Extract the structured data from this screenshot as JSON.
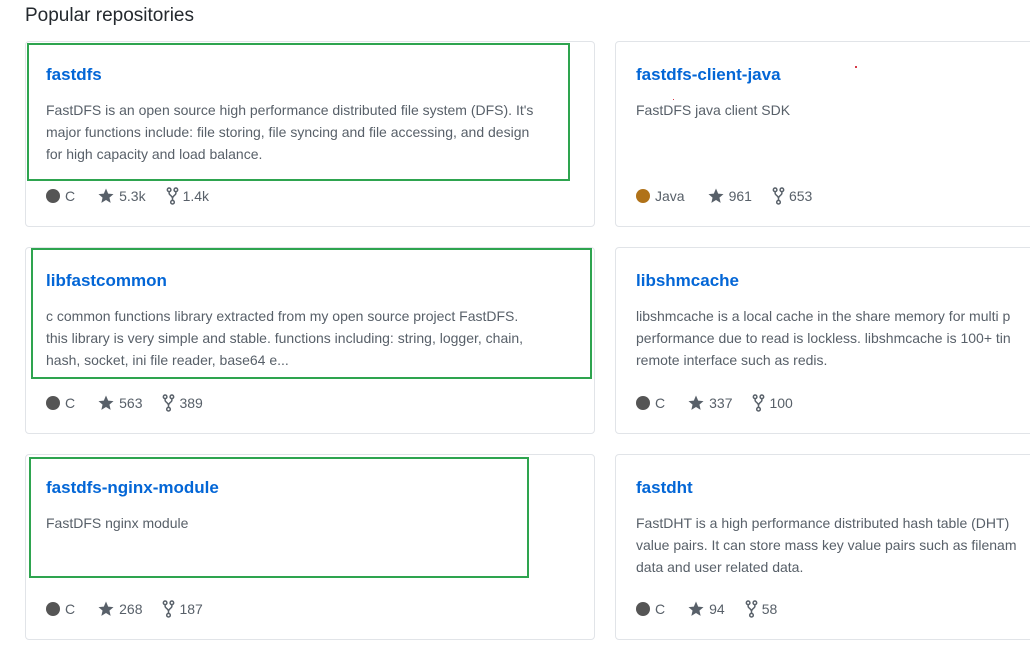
{
  "section": {
    "title": "Popular repositories"
  },
  "colors": {
    "link": "#0366d6",
    "text_muted": "#586069",
    "border": "#e1e4e8",
    "highlight": "#2ea44f"
  },
  "languages": {
    "C": "#555555",
    "Java": "#b07219"
  },
  "repos": [
    {
      "name": "fastdfs",
      "description": "FastDFS is an open source high performance distributed file system (DFS). It's\nmajor functions include: file storing, file syncing and file accessing, and design\nfor high capacity and load balance.",
      "language": "C",
      "language_color": "#555555",
      "stars": "5.3k",
      "forks": "1.4k"
    },
    {
      "name": "fastdfs-client-java",
      "description": "FastDFS java client SDK",
      "language": "Java",
      "language_color": "#b07219",
      "stars": "961",
      "forks": "653"
    },
    {
      "name": "libfastcommon",
      "description": "c common functions library extracted from my open source project FastDFS.\nthis library is very simple and stable. functions including: string, logger, chain,\nhash, socket, ini file reader, base64 e...",
      "language": "C",
      "language_color": "#555555",
      "stars": "563",
      "forks": "389"
    },
    {
      "name": "libshmcache",
      "description": "libshmcache is a local cache in the share memory for multi p\nperformance due to read is lockless. libshmcache is 100+ tin\nremote interface such as redis.",
      "language": "C",
      "language_color": "#555555",
      "stars": "337",
      "forks": "100"
    },
    {
      "name": "fastdfs-nginx-module",
      "description": "FastDFS nginx module",
      "language": "C",
      "language_color": "#555555",
      "stars": "268",
      "forks": "187"
    },
    {
      "name": "fastdht",
      "description": "FastDHT is a high performance distributed hash table (DHT)\nvalue pairs. It can store mass key value pairs such as filenam\ndata and user related data.",
      "language": "C",
      "language_color": "#555555",
      "stars": "94",
      "forks": "58"
    }
  ]
}
